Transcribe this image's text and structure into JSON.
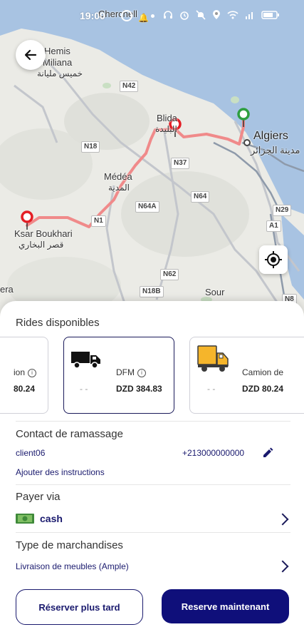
{
  "status_bar": {
    "time": "19:00"
  },
  "map": {
    "places": [
      {
        "name": "Cherchell"
      },
      {
        "name": "Hemis"
      },
      {
        "name": "Miliana"
      },
      {
        "name": "خميس مليانة"
      },
      {
        "name": "Blida"
      },
      {
        "name": "البليدة"
      },
      {
        "name": "Algiers"
      },
      {
        "name": "مدينة الجزائر"
      },
      {
        "name": "Médéa"
      },
      {
        "name": "المدية"
      },
      {
        "name": "Ksar Boukhari"
      },
      {
        "name": "قصر البخاري"
      },
      {
        "name": "Sour"
      },
      {
        "name": "era"
      }
    ],
    "roads": [
      "N42",
      "N18",
      "N37",
      "N64",
      "N64A",
      "N1",
      "N29",
      "A1",
      "N62",
      "N18B",
      "N8"
    ]
  },
  "rides": {
    "title": "Rides disponibles",
    "cards": [
      {
        "name": "ion",
        "price": "80.24",
        "selected": false
      },
      {
        "name": "DFM",
        "price": "DZD 384.83",
        "eta": "- -",
        "selected": true
      },
      {
        "name": "Camion de",
        "price": "DZD 80.24",
        "eta": "- -",
        "selected": false
      }
    ]
  },
  "pickup": {
    "title": "Contact de ramassage",
    "client": "client06",
    "phone": "+213000000000",
    "add_instructions": "Ajouter des instructions"
  },
  "payment": {
    "title": "Payer via",
    "method": "cash"
  },
  "goods": {
    "title": "Type de marchandises",
    "value": "Livraison de meubles (Ample)"
  },
  "actions": {
    "later": "Réserver plus tard",
    "now": "Reserve maintenant"
  },
  "colors": {
    "route": "#f08a8a",
    "navy": "#0f0f7a",
    "marker_red": "#e41e25",
    "marker_green": "#2e9e3f"
  }
}
